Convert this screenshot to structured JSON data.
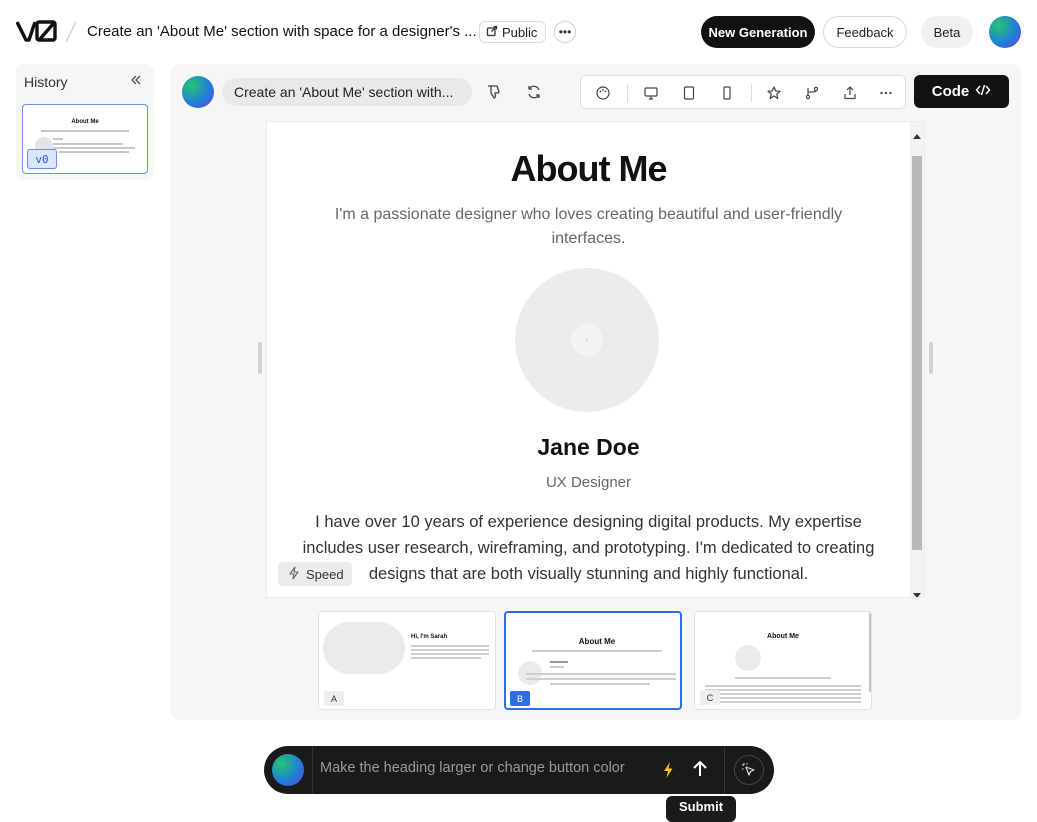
{
  "header": {
    "logo_text": "v0",
    "title": "Create an 'About Me' section with space for a designer's ...",
    "visibility_label": "Public",
    "new_generation_label": "New Generation",
    "feedback_label": "Feedback",
    "beta_label": "Beta"
  },
  "history": {
    "title": "History",
    "items": [
      {
        "version_label": "v0",
        "thumb_heading": "About Me"
      }
    ]
  },
  "generation": {
    "prompt": "Create an 'About Me' section with...",
    "code_label": "Code"
  },
  "preview": {
    "heading": "About Me",
    "subtitle": "I'm a passionate designer who loves creating beautiful and user-friendly interfaces.",
    "name": "Jane Doe",
    "role": "UX Designer",
    "bio": "I have over 10 years of experience designing digital products. My expertise includes user research, wireframing, and prototyping. I'm dedicated to creating designs that are both visually stunning and highly functional.",
    "speed_label": "Speed"
  },
  "variants": [
    {
      "label": "A",
      "heading": "Hi, I'm Sarah",
      "selected": false
    },
    {
      "label": "B",
      "heading": "About Me",
      "selected": true
    },
    {
      "label": "C",
      "heading": "About Me",
      "selected": false
    }
  ],
  "composer": {
    "placeholder": "Make the heading larger or change button color",
    "submit_tooltip": "Submit"
  },
  "colors": {
    "accent": "#2f6ee0",
    "primary_button": "#111111",
    "composer_bg": "#1a1a1a",
    "bolt": "#f5c518"
  }
}
